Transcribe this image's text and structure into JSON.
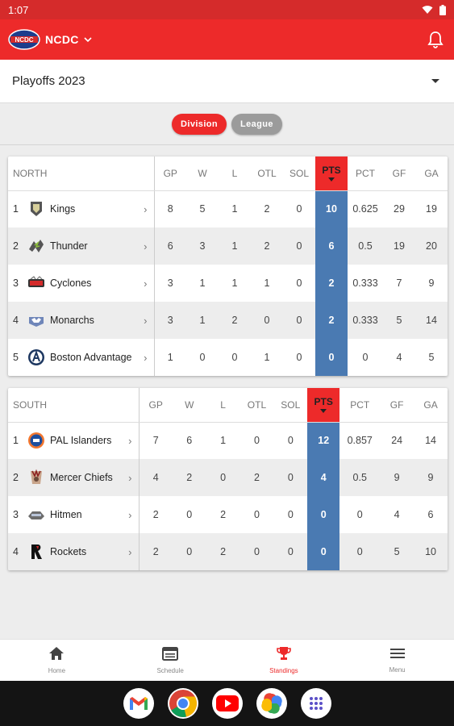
{
  "status": {
    "time": "1:07"
  },
  "app": {
    "title": "NCDC",
    "logo_text": "NCDC"
  },
  "season": {
    "selected": "Playoffs 2023"
  },
  "toggle": {
    "division": "Division",
    "league": "League"
  },
  "columns": [
    "GP",
    "W",
    "L",
    "OTL",
    "SOL",
    "PTS",
    "PCT",
    "GF",
    "GA"
  ],
  "north": {
    "label": "NORTH",
    "teams": [
      {
        "rank": "1",
        "name": "Kings",
        "gp": "8",
        "w": "5",
        "l": "1",
        "otl": "2",
        "sol": "0",
        "pts": "10",
        "pct": "0.625",
        "gf": "29",
        "ga": "19"
      },
      {
        "rank": "2",
        "name": "Thunder",
        "gp": "6",
        "w": "3",
        "l": "1",
        "otl": "2",
        "sol": "0",
        "pts": "6",
        "pct": "0.5",
        "gf": "19",
        "ga": "20"
      },
      {
        "rank": "3",
        "name": "Cyclones",
        "gp": "3",
        "w": "1",
        "l": "1",
        "otl": "1",
        "sol": "0",
        "pts": "2",
        "pct": "0.333",
        "gf": "7",
        "ga": "9"
      },
      {
        "rank": "4",
        "name": "Monarchs",
        "gp": "3",
        "w": "1",
        "l": "2",
        "otl": "0",
        "sol": "0",
        "pts": "2",
        "pct": "0.333",
        "gf": "5",
        "ga": "14"
      },
      {
        "rank": "5",
        "name": "Boston Advantage",
        "gp": "1",
        "w": "0",
        "l": "0",
        "otl": "1",
        "sol": "0",
        "pts": "0",
        "pct": "0",
        "gf": "4",
        "ga": "5"
      }
    ]
  },
  "south": {
    "label": "SOUTH",
    "teams": [
      {
        "rank": "1",
        "name": "PAL Islanders",
        "gp": "7",
        "w": "6",
        "l": "1",
        "otl": "0",
        "sol": "0",
        "pts": "12",
        "pct": "0.857",
        "gf": "24",
        "ga": "14"
      },
      {
        "rank": "2",
        "name": "Mercer Chiefs",
        "gp": "4",
        "w": "2",
        "l": "0",
        "otl": "2",
        "sol": "0",
        "pts": "4",
        "pct": "0.5",
        "gf": "9",
        "ga": "9"
      },
      {
        "rank": "3",
        "name": "Hitmen",
        "gp": "2",
        "w": "0",
        "l": "2",
        "otl": "0",
        "sol": "0",
        "pts": "0",
        "pct": "0",
        "gf": "4",
        "ga": "6"
      },
      {
        "rank": "4",
        "name": "Rockets",
        "gp": "2",
        "w": "0",
        "l": "2",
        "otl": "0",
        "sol": "0",
        "pts": "0",
        "pct": "0",
        "gf": "5",
        "ga": "10"
      }
    ]
  },
  "nav": {
    "home": "Home",
    "schedule": "Schedule",
    "standings": "Standings",
    "menu": "Menu"
  },
  "colors": {
    "brand_red": "#ed2a2a",
    "pts_blue": "#4a7ab2",
    "inactive_pill": "#9b9b9b"
  },
  "icons": [
    "wifi-icon",
    "battery-icon",
    "bell-icon",
    "home-icon",
    "schedule-icon",
    "trophy-icon",
    "menu-icon",
    "gmail-icon",
    "chrome-icon",
    "youtube-icon",
    "photos-icon",
    "apps-icon"
  ]
}
